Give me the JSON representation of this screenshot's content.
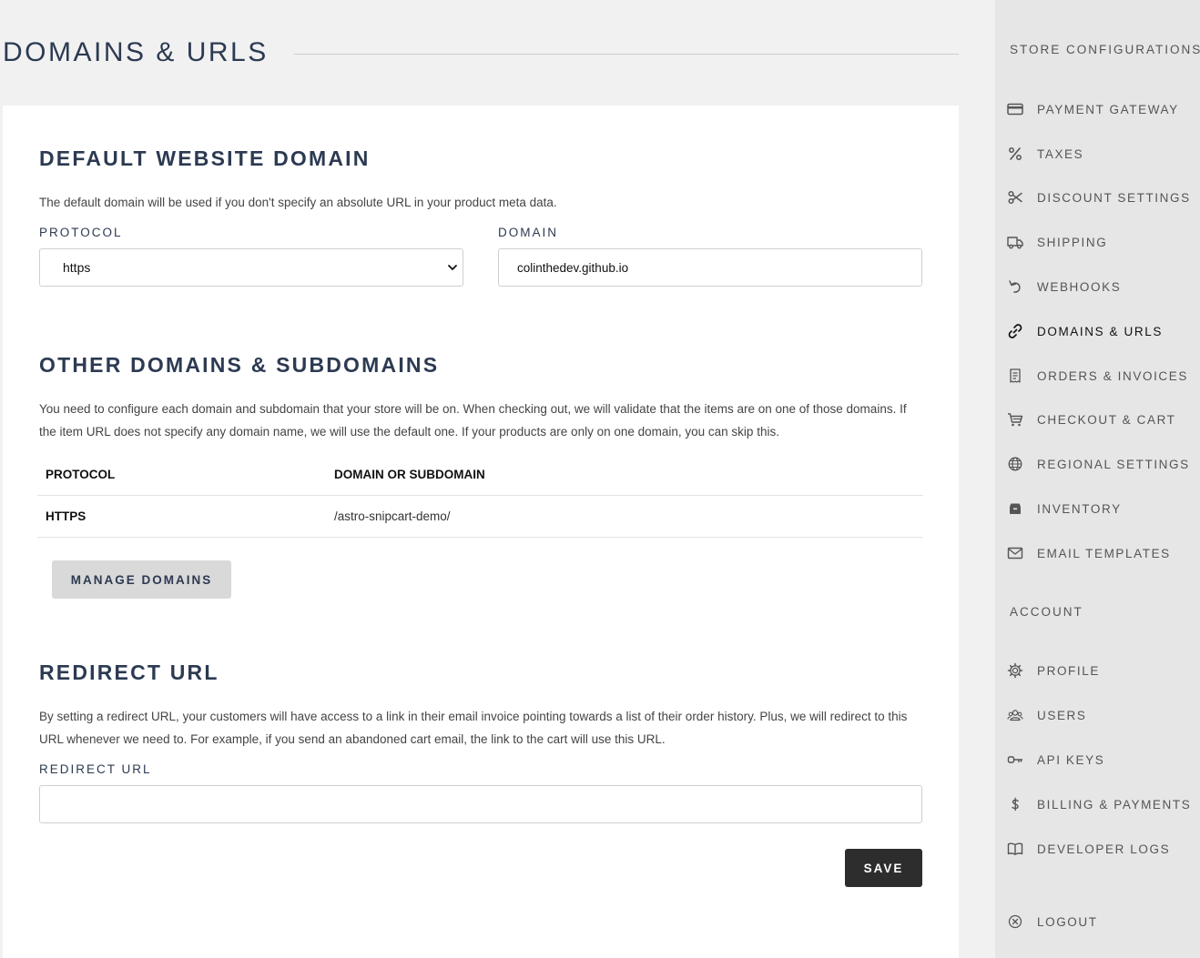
{
  "page": {
    "title": "DOMAINS & URLS"
  },
  "default_domain": {
    "title": "DEFAULT WEBSITE DOMAIN",
    "description": "The default domain will be used if you don't specify an absolute URL in your product meta data.",
    "protocol_label": "PROTOCOL",
    "protocol_value": "https",
    "domain_label": "DOMAIN",
    "domain_value": "colinthedev.github.io"
  },
  "other_domains": {
    "title": "OTHER DOMAINS & SUBDOMAINS",
    "description": "You need to configure each domain and subdomain that your store will be on. When checking out, we will validate that the items are on one of those domains. If the item URL does not specify any domain name, we will use the default one. If your products are only on one domain, you can skip this.",
    "columns": [
      "PROTOCOL",
      "DOMAIN OR SUBDOMAIN"
    ],
    "rows": [
      {
        "protocol": "HTTPS",
        "domain": "/astro-snipcart-demo/"
      }
    ],
    "manage_button": "MANAGE DOMAINS"
  },
  "redirect": {
    "title": "REDIRECT URL",
    "description": "By setting a redirect URL, your customers will have access to a link in their email invoice pointing towards a list of their order history. Plus, we will redirect to this URL whenever we need to. For example, if you send an abandoned cart email, the link to the cart will use this URL.",
    "label": "REDIRECT URL",
    "value": "",
    "save_button": "SAVE"
  },
  "sidebar": {
    "store_heading": "STORE CONFIGURATIONS",
    "store_items": [
      {
        "label": "PAYMENT GATEWAY",
        "icon": "credit-card-icon"
      },
      {
        "label": "TAXES",
        "icon": "percent-icon"
      },
      {
        "label": "DISCOUNT SETTINGS",
        "icon": "scissors-icon"
      },
      {
        "label": "SHIPPING",
        "icon": "truck-icon"
      },
      {
        "label": "WEBHOOKS",
        "icon": "undo-arrow-icon"
      },
      {
        "label": "DOMAINS & URLS",
        "icon": "link-icon",
        "active": true
      },
      {
        "label": "ORDERS & INVOICES",
        "icon": "receipt-icon"
      },
      {
        "label": "CHECKOUT & CART",
        "icon": "cart-icon"
      },
      {
        "label": "REGIONAL SETTINGS",
        "icon": "globe-icon"
      },
      {
        "label": "INVENTORY",
        "icon": "box-icon"
      },
      {
        "label": "EMAIL TEMPLATES",
        "icon": "envelope-icon"
      }
    ],
    "account_heading": "ACCOUNT",
    "account_items": [
      {
        "label": "PROFILE",
        "icon": "gear-icon"
      },
      {
        "label": "USERS",
        "icon": "users-icon"
      },
      {
        "label": "API KEYS",
        "icon": "key-icon"
      },
      {
        "label": "BILLING & PAYMENTS",
        "icon": "dollar-icon"
      },
      {
        "label": "DEVELOPER LOGS",
        "icon": "book-icon"
      }
    ],
    "logout_label": "LOGOUT",
    "logout_icon": "close-circle-icon"
  }
}
